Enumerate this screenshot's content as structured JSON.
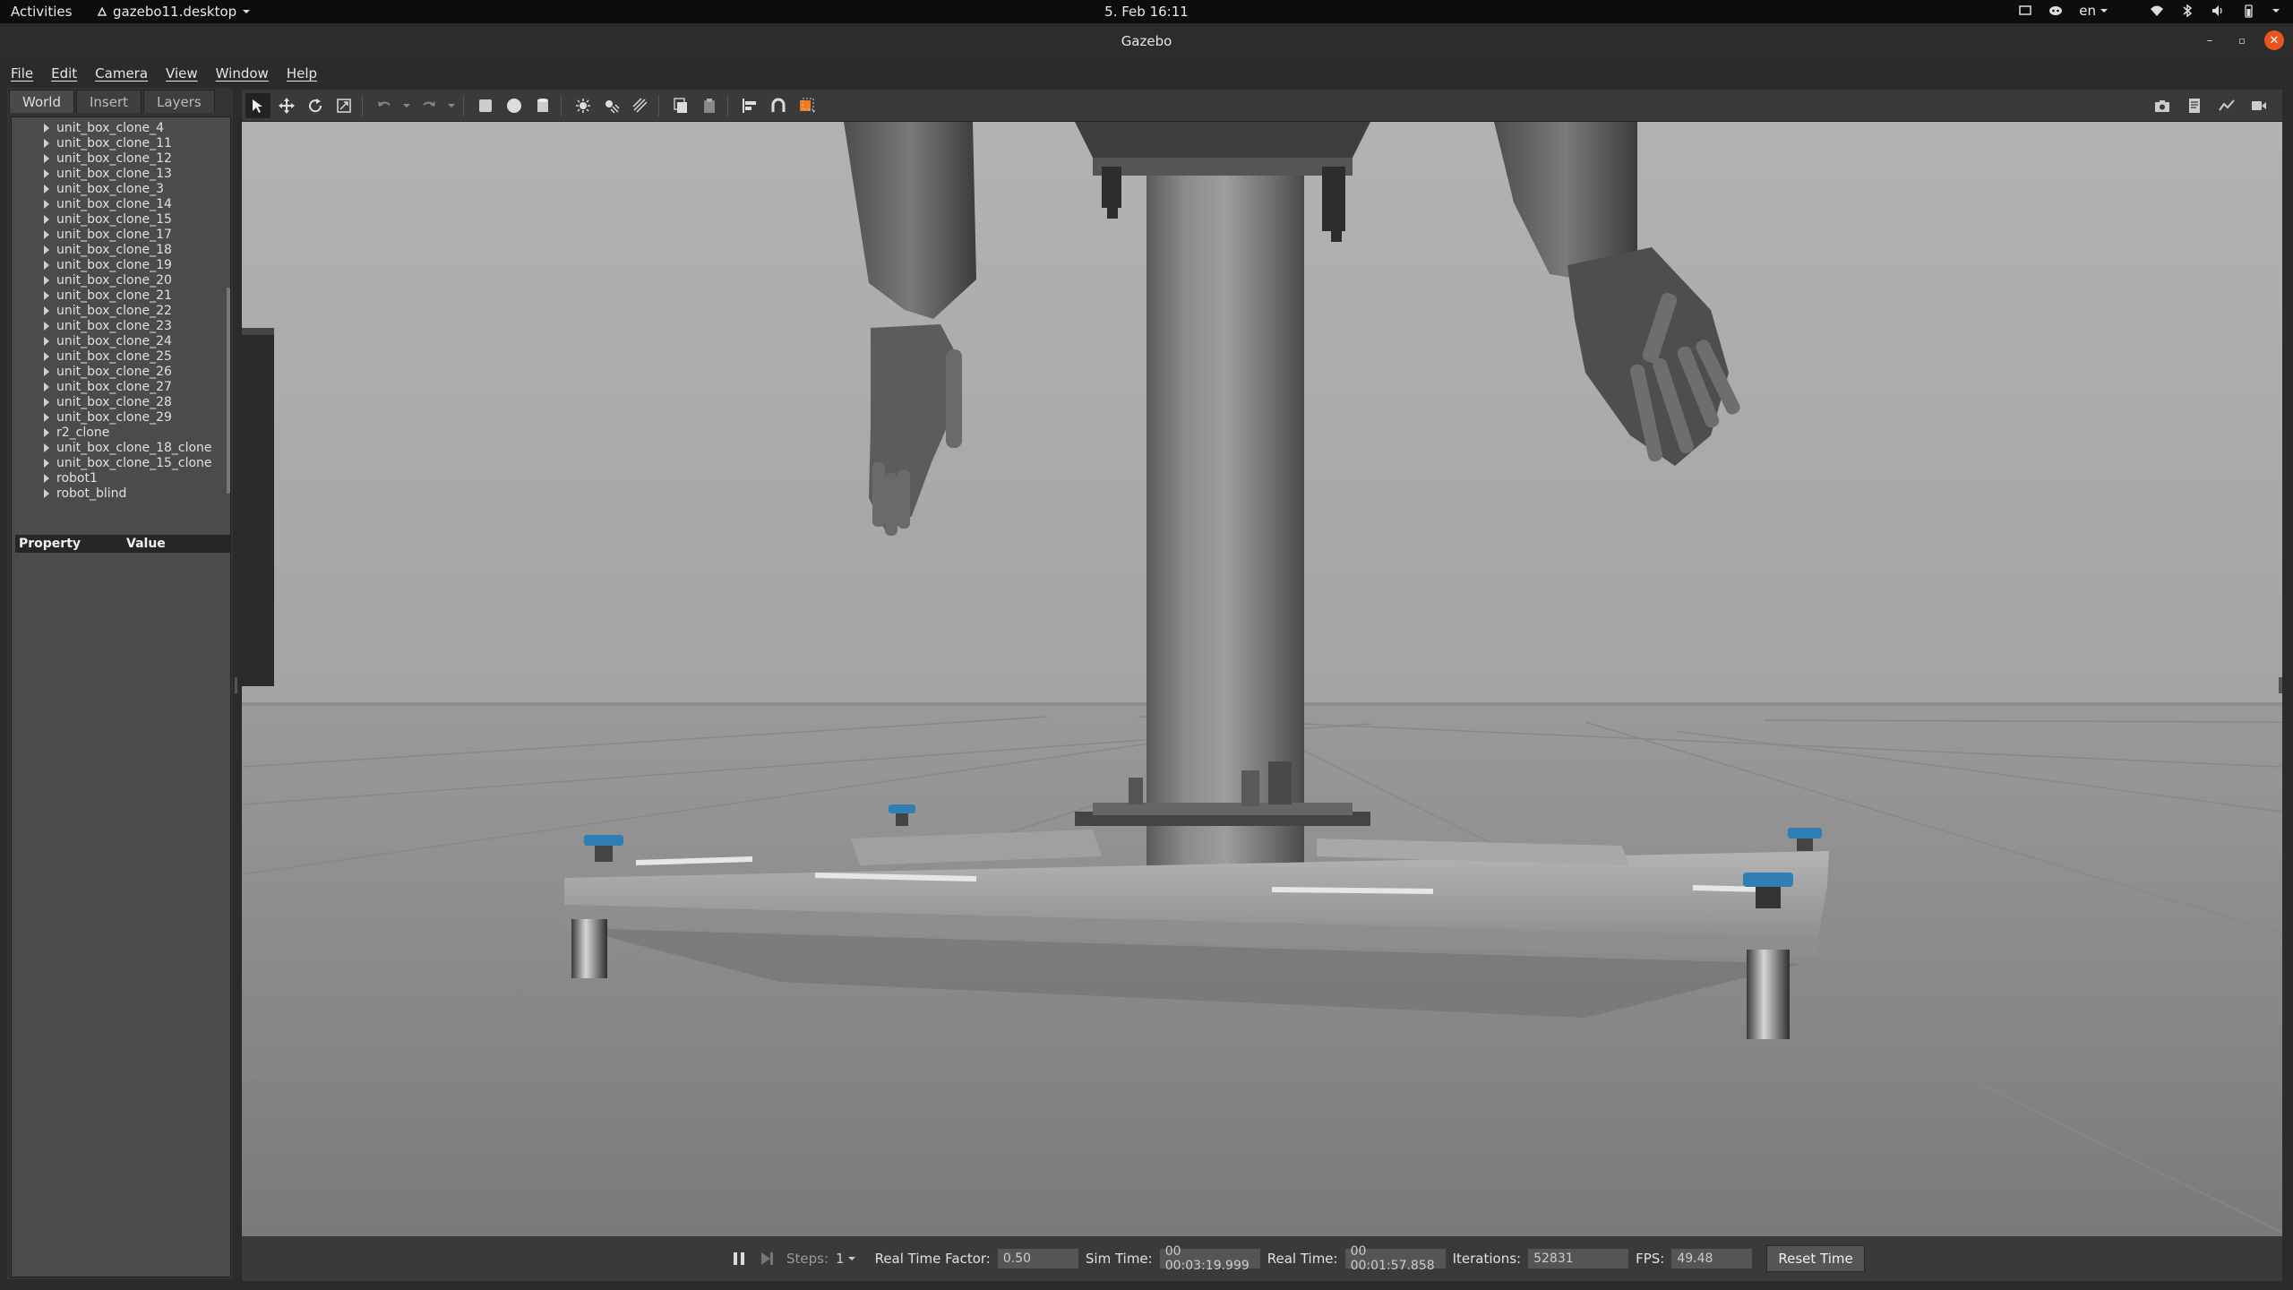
{
  "topbar": {
    "activities": "Activities",
    "app_name": "gazebo11.desktop",
    "clock": "5. Feb  16:11",
    "language": "en",
    "tray_icons": [
      "screen-icon",
      "discord-icon",
      "wifi-icon",
      "bluetooth-icon",
      "volume-icon",
      "battery-icon",
      "chevron-down-icon"
    ]
  },
  "window": {
    "title": "Gazebo",
    "controls": [
      "minimize-icon",
      "maximize-icon",
      "close-icon"
    ],
    "close_color": "#e95420"
  },
  "menubar": {
    "items": [
      "File",
      "Edit",
      "Camera",
      "View",
      "Window",
      "Help"
    ]
  },
  "left_panel": {
    "tabs": [
      "World",
      "Insert",
      "Layers"
    ],
    "active_tab": "World",
    "tree_items": [
      "unit_box_clone_4",
      "unit_box_clone_11",
      "unit_box_clone_12",
      "unit_box_clone_13",
      "unit_box_clone_3",
      "unit_box_clone_14",
      "unit_box_clone_15",
      "unit_box_clone_17",
      "unit_box_clone_18",
      "unit_box_clone_19",
      "unit_box_clone_20",
      "unit_box_clone_21",
      "unit_box_clone_22",
      "unit_box_clone_23",
      "unit_box_clone_24",
      "unit_box_clone_25",
      "unit_box_clone_26",
      "unit_box_clone_27",
      "unit_box_clone_28",
      "unit_box_clone_29",
      "r2_clone",
      "unit_box_clone_18_clone",
      "unit_box_clone_15_clone",
      "robot1",
      "robot_blind"
    ],
    "property_header": {
      "property": "Property",
      "value": "Value"
    }
  },
  "toolbar": {
    "tools": [
      "select-icon",
      "translate-icon",
      "rotate-icon",
      "scale-icon",
      "undo-icon",
      "undo-dropdown-icon",
      "redo-icon",
      "redo-dropdown-icon",
      "box-icon",
      "sphere-icon",
      "cylinder-icon",
      "point-light-icon",
      "spot-light-icon",
      "directional-light-icon",
      "copy-icon",
      "paste-icon",
      "align-icon",
      "snap-icon",
      "view-angle-icon"
    ],
    "right_tools": [
      "screenshot-icon",
      "log-icon",
      "plot-icon",
      "record-icon"
    ],
    "accent": "#f07a1e"
  },
  "statusbar": {
    "steps_label": "Steps:",
    "steps_value": "1",
    "rtf_label": "Real Time Factor:",
    "rtf_value": "0.50",
    "sim_time_label": "Sim Time:",
    "sim_time_value": "00 00:03:19.999",
    "real_time_label": "Real Time:",
    "real_time_value": "00 00:01:57.858",
    "iterations_label": "Iterations:",
    "iterations_value": "52831",
    "fps_label": "FPS:",
    "fps_value": "49.48",
    "reset_label": "Reset Time"
  }
}
